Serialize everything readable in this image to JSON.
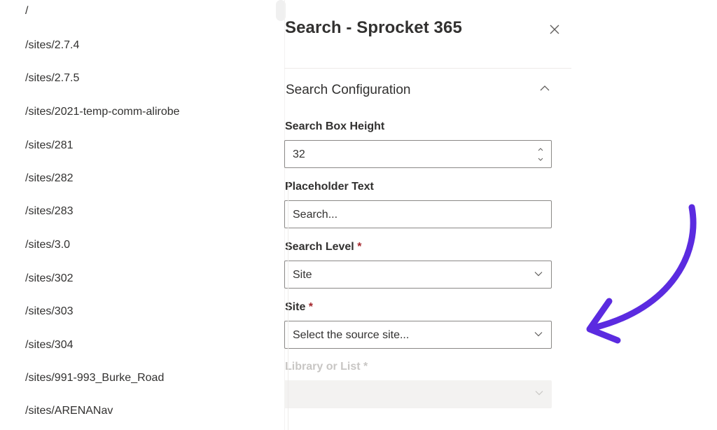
{
  "site_list": {
    "items": [
      "/",
      "/sites/2.7.4",
      "/sites/2.7.5",
      "/sites/2021-temp-comm-alirobe",
      "/sites/281",
      "/sites/282",
      "/sites/283",
      "/sites/3.0",
      "/sites/302",
      "/sites/303",
      "/sites/304",
      "/sites/991-993_Burke_Road",
      "/sites/ARENANav"
    ]
  },
  "panel": {
    "title": "Search - Sprocket 365",
    "close_icon": "close-icon",
    "section_title": "Search Configuration",
    "section_state": "expanded",
    "fields": {
      "search_box_height": {
        "label": "Search Box Height",
        "value": "32"
      },
      "placeholder_text": {
        "label": "Placeholder Text",
        "value": "Search..."
      },
      "search_level": {
        "label": "Search Level",
        "required_mark": "*",
        "value": "Site"
      },
      "site": {
        "label": "Site",
        "required_mark": "*",
        "placeholder": "Select the source site..."
      },
      "library_or_list": {
        "label": "Library or List",
        "required_mark": "*",
        "value": ""
      }
    }
  },
  "annotation": {
    "icon": "curved-arrow-icon",
    "color": "#5b2be0"
  },
  "colors": {
    "required": "#a4262c",
    "border": "#8a8886",
    "disabled_bg": "#f3f2f1"
  }
}
